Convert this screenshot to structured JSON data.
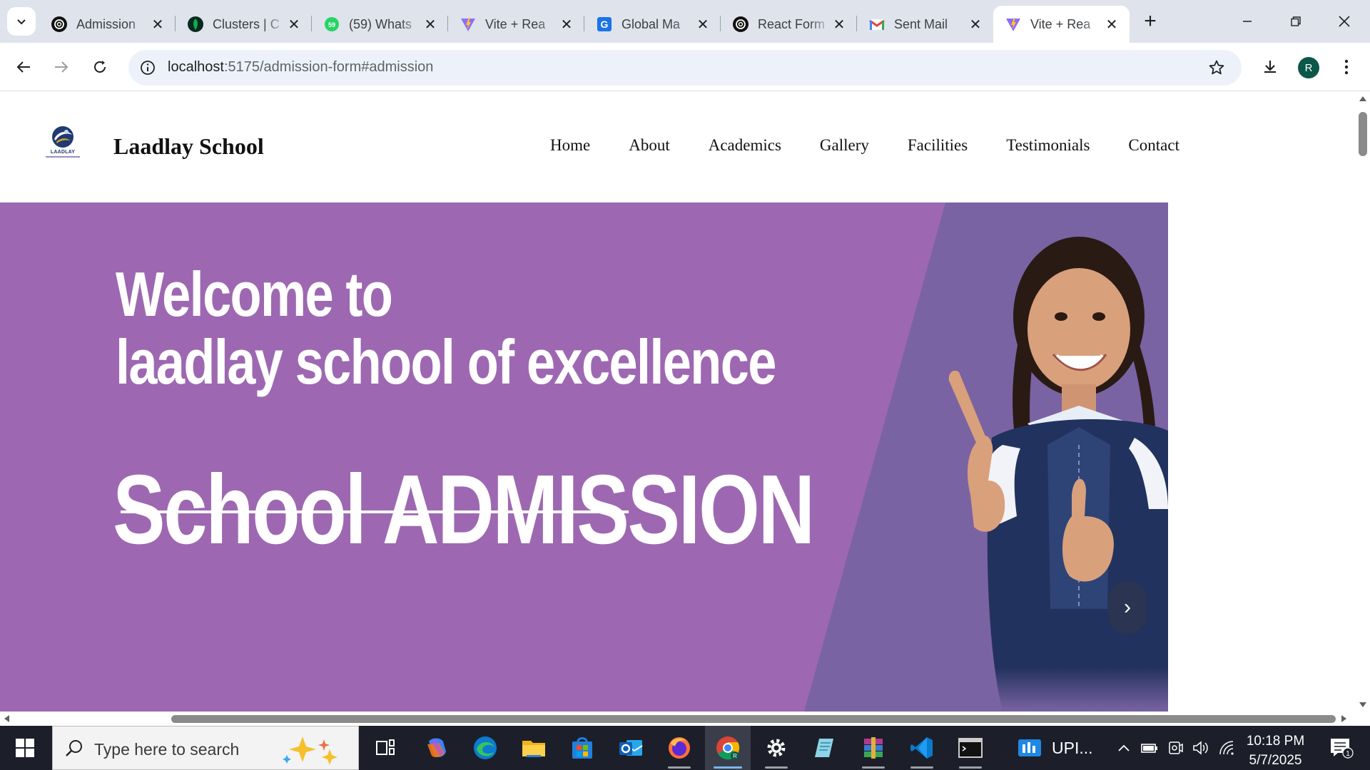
{
  "browser": {
    "tabs": [
      {
        "title": "Admission",
        "icon": "openai-icon"
      },
      {
        "title": "Clusters | C",
        "icon": "mongodb-leaf-icon"
      },
      {
        "title": "(59) Whats",
        "icon": "whatsapp-icon",
        "badge": "59"
      },
      {
        "title": "Vite + Rea",
        "icon": "vite-icon"
      },
      {
        "title": "Global Ma",
        "icon": "g-doc-icon"
      },
      {
        "title": "React Form",
        "icon": "openai-icon"
      },
      {
        "title": "Sent Mail",
        "icon": "gmail-icon"
      },
      {
        "title": "Vite + Rea",
        "icon": "vite-icon",
        "active": true
      }
    ],
    "url_host": "localhost",
    "url_rest": ":5175/admission-form#admission",
    "profile_initial": "R"
  },
  "site": {
    "name": "Laadlay School",
    "logo_text": "LAADLAY",
    "nav": [
      "Home",
      "About",
      "Academics",
      "Gallery",
      "Facilities",
      "Testimonials",
      "Contact"
    ]
  },
  "hero": {
    "line1": "Welcome to",
    "line2": "laadlay school of excellence",
    "line3": "School ADMISSION",
    "next_symbol": "›",
    "colors": {
      "bg": "#9d68b1",
      "panel": "#7a63a3"
    }
  },
  "taskbar": {
    "search_placeholder": "Type here to search",
    "pinned_app_label": "UPI...",
    "time": "10:18 PM",
    "date": "5/7/2025",
    "notification_count": "1"
  }
}
